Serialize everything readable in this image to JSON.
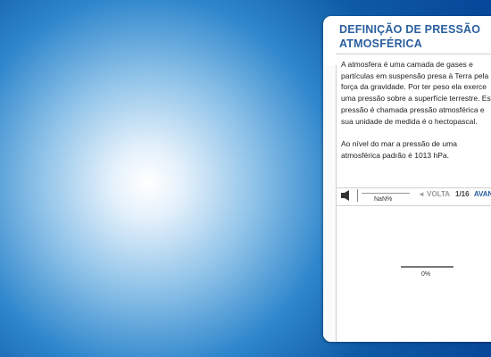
{
  "panel": {
    "title": "DEFINIÇÃO DE PRESSÃO ATMOSFÉRICA",
    "paragraphs": [
      "A atmosfera é uma camada de gases e partículas em suspensão presa à Terra pela força da gravidade.  Por ter peso ela exerce uma pressão sobre a superfície terrestre. Esta pressão é chamada pressão atmosférica e sua unidade de medida é o hectopascal.",
      "Ao nível do mar a pressão de uma atmosférica padrão é 1013 hPa."
    ]
  },
  "controls": {
    "speaker_icon": "speaker-icon",
    "audio_percent": "NaN%",
    "back_label": "◄ VOLTA",
    "page_counter": "1/16",
    "next_label": "AVANÇA ►"
  },
  "loader": {
    "percent_label": "0%",
    "progress": 0
  },
  "colors": {
    "accent": "#2a5f9e",
    "background_center": "#ffffff",
    "background_edge": "#08489a"
  }
}
